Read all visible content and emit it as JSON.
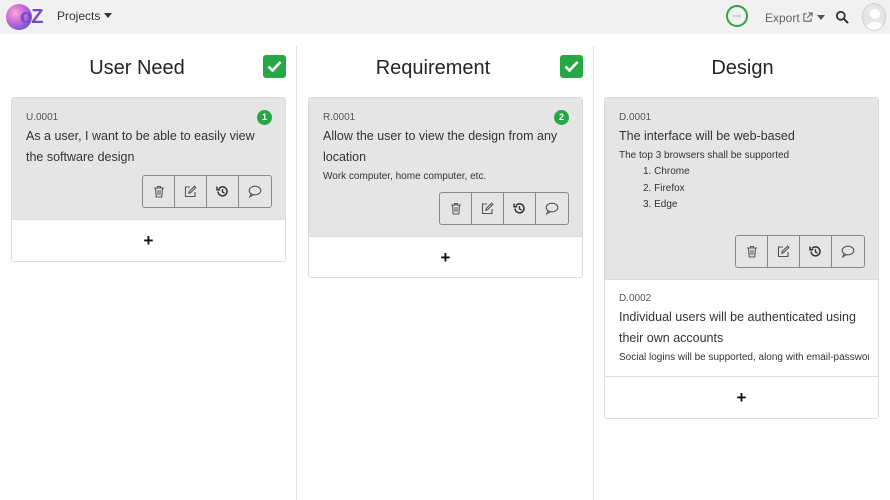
{
  "navbar": {
    "logo_text": "oZ",
    "projects_label": "Projects",
    "export_label": "Export"
  },
  "columns": [
    {
      "title": "User Need",
      "items": [
        {
          "id": "U.0001",
          "title": "As a user, I want to be able to easily view the software design",
          "badge": "1"
        }
      ]
    },
    {
      "title": "Requirement",
      "items": [
        {
          "id": "R.0001",
          "title": "Allow the user to view the design from any location",
          "description": "Work computer, home computer, etc.",
          "badge": "2"
        }
      ]
    },
    {
      "title": "Design",
      "items": [
        {
          "id": "D.0001",
          "title": "The interface will be web-based",
          "description": "The top 3 browsers shall be supported",
          "list": [
            "1. Chrome",
            "2. Firefox",
            "3. Edge"
          ]
        },
        {
          "id": "D.0002",
          "title": "Individual users will be authenticated using their own accounts",
          "description": "Social logins will be supported, along with email-password ..."
        }
      ]
    }
  ],
  "add_label": "+",
  "icons": [
    "delete-icon",
    "edit-icon",
    "history-icon",
    "comment-icon",
    "check-icon",
    "search-icon",
    "external-link-icon",
    "user-avatar-icon"
  ],
  "colors": {
    "success": "#28a745",
    "navbar_bg": "#f1f1f1",
    "card_selected_bg": "#e5e5e5"
  }
}
